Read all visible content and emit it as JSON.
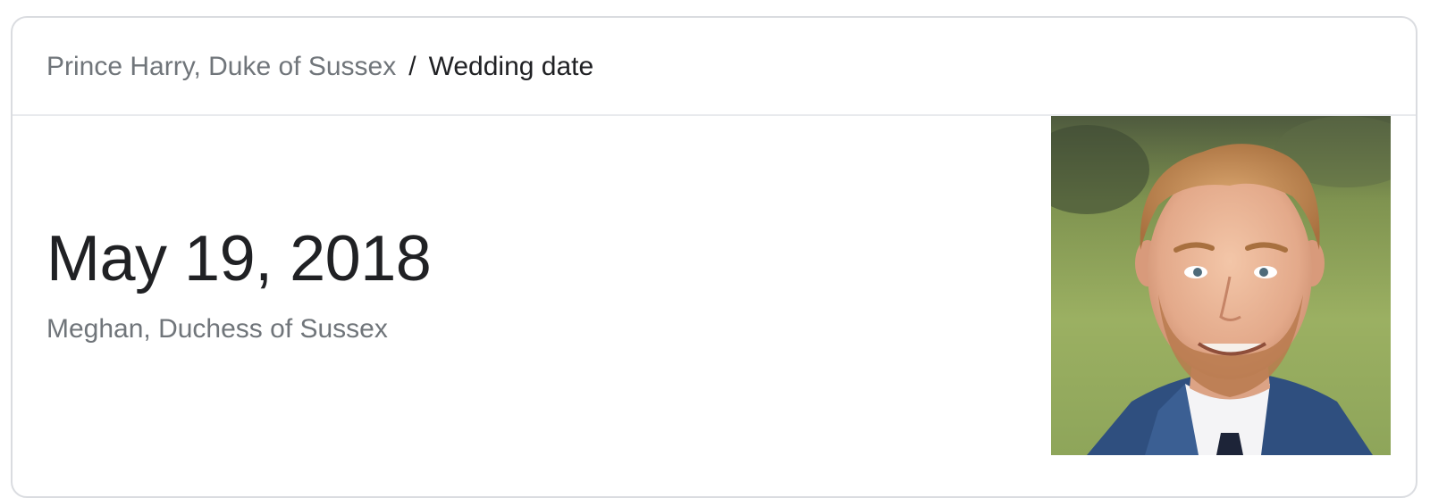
{
  "breadcrumb": {
    "entity": "Prince Harry, Duke of Sussex",
    "separator": "/",
    "attribute": "Wedding date"
  },
  "answer": {
    "date": "May 19, 2018",
    "spouse": "Meghan, Duchess of Sussex"
  },
  "photo": {
    "subject": "portrait-photo"
  },
  "colors": {
    "border": "#dadce0",
    "muted_text": "#70757a",
    "primary_text": "#202124"
  }
}
